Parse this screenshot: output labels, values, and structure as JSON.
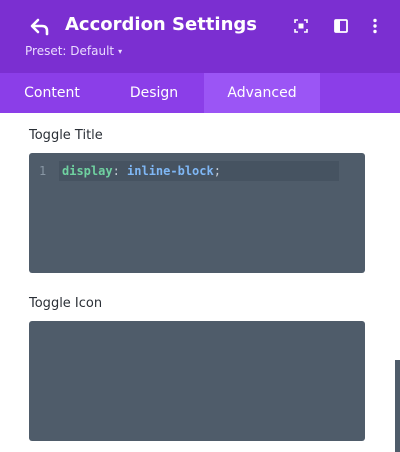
{
  "header": {
    "title": "Accordion Settings",
    "preset_label": "Preset: Default",
    "icons": [
      "back-arrow-icon",
      "focus-icon",
      "sidebar-toggle-icon",
      "more-vertical-icon"
    ],
    "colors": {
      "header_bg": "#7b2fd1",
      "tabs_bg": "#8b3ee8",
      "active_tab_bg": "#9b55f5"
    }
  },
  "tabs": [
    {
      "label": "Content",
      "active": false
    },
    {
      "label": "Design",
      "active": false
    },
    {
      "label": "Advanced",
      "active": true
    }
  ],
  "sections": {
    "toggle_title": {
      "label": "Toggle Title",
      "line_number": "1",
      "code_property": "display",
      "code_colon": ": ",
      "code_value": "inline-block",
      "code_semicolon": ";"
    },
    "toggle_icon": {
      "label": "Toggle Icon"
    }
  }
}
